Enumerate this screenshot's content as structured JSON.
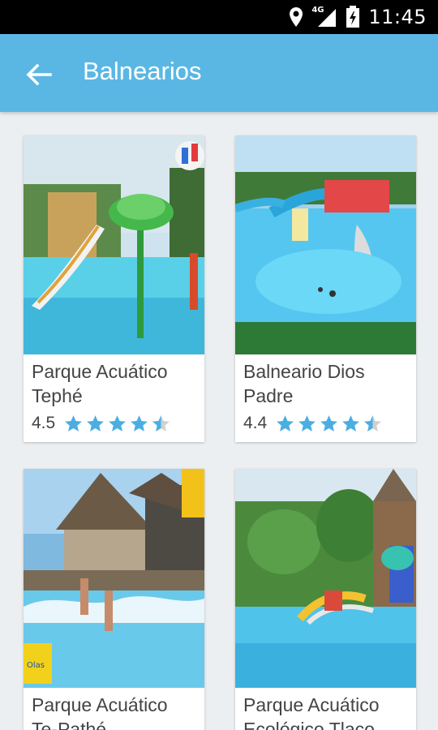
{
  "status_bar": {
    "time": "11:45",
    "network": "4G",
    "icons": [
      "location-icon",
      "signal-icon",
      "battery-icon"
    ]
  },
  "app_bar": {
    "title": "Balnearios",
    "back_icon": "arrow-left-icon",
    "color": "#5ab7e4"
  },
  "cards": [
    {
      "title": "Parque Acuático Tephé",
      "rating": "4.5",
      "stars": 4.5
    },
    {
      "title": "Balneario Dios Padre",
      "rating": "4.4",
      "stars": 4.5
    },
    {
      "title": "Parque Acuático Te-Pathé",
      "rating": "",
      "stars": null
    },
    {
      "title": "Parque Acuático Ecológico Tlaco",
      "rating": "",
      "stars": null
    }
  ],
  "colors": {
    "star": "#4aaee2",
    "star_empty": "#d0d0d0"
  }
}
